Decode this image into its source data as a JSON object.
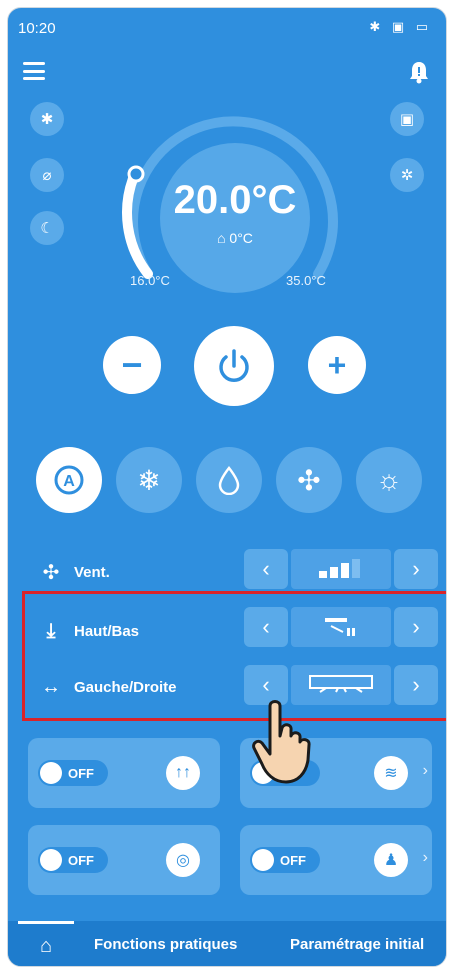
{
  "status_bar": {
    "time": "10:20",
    "right_icons": "✱ ▣ ▭"
  },
  "header": {
    "menu_icon": "hamburger-icon",
    "bell_icon": "bell-icon"
  },
  "side_buttons_left": [
    "bluetooth-icon",
    "no-fan-icon",
    "moon-timer-icon"
  ],
  "side_buttons_right": [
    "schedule-icon",
    "fan-spin-icon"
  ],
  "temperature": {
    "setpoint": "20.0°C",
    "inside": "0°C",
    "min": "16.0°C",
    "max": "35.0°C"
  },
  "controls": {
    "minus": "−",
    "plus": "+"
  },
  "modes": [
    {
      "name": "auto",
      "label": "A",
      "active": true
    },
    {
      "name": "cool",
      "label": "❄",
      "active": false
    },
    {
      "name": "dry",
      "label": "💧",
      "active": false
    },
    {
      "name": "fan",
      "label": "✣",
      "active": false
    },
    {
      "name": "heat",
      "label": "☼",
      "active": false
    }
  ],
  "rows": {
    "vent": {
      "label": "Vent.",
      "icon": "fan-icon"
    },
    "haut_bas": {
      "label": "Haut/Bas",
      "icon": "vertical-swing-icon"
    },
    "gauche_droite": {
      "label": "Gauche/Droite",
      "icon": "horizontal-swing-icon"
    }
  },
  "cards": [
    {
      "toggle": "OFF",
      "icon": "airflow-icon"
    },
    {
      "toggle": "",
      "icon": "waves-icon"
    },
    {
      "toggle": "OFF",
      "icon": "bulb-icon"
    },
    {
      "toggle": "OFF",
      "icon": "person-icon"
    }
  ],
  "bottom_nav": {
    "home": "home-icon",
    "tab1": "Fonctions pratiques",
    "tab2": "Paramétrage initial"
  },
  "colors": {
    "background": "#2f8fde",
    "button": "#5aaae9",
    "highlight": "#d9242a"
  }
}
